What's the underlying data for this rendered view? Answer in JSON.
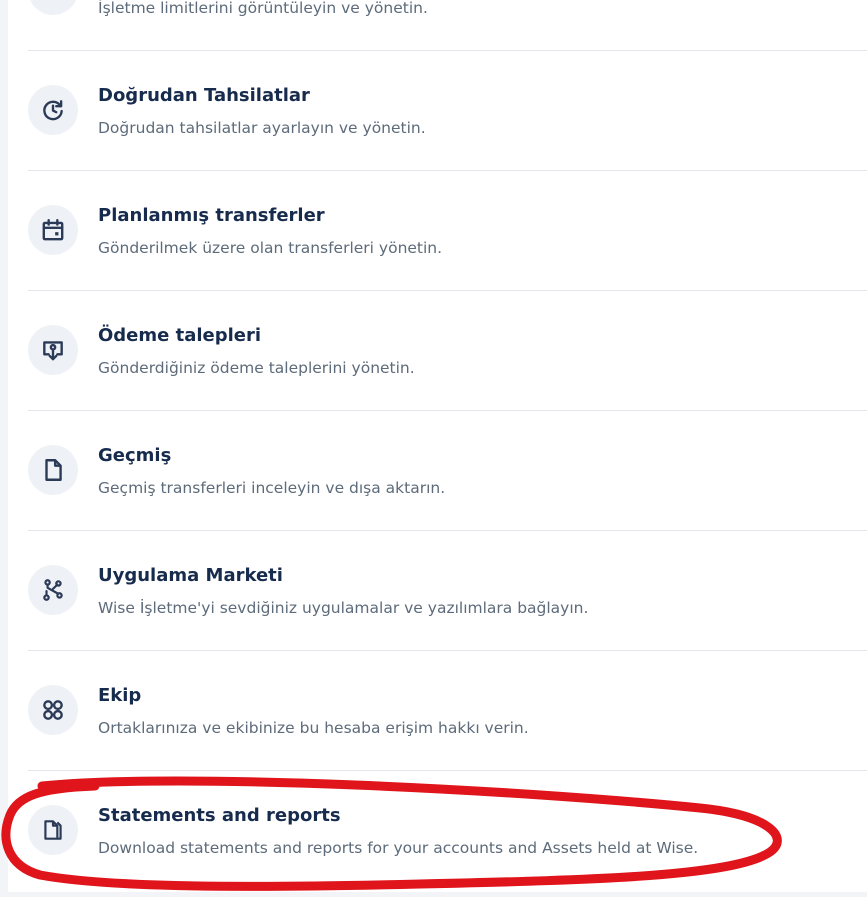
{
  "menu": {
    "items": [
      {
        "title": "",
        "description": "İşletme limitlerini görüntüleyin ve yönetin.",
        "icon": "gauge-icon"
      },
      {
        "title": "Doğrudan Tahsilatlar",
        "description": "Doğrudan tahsilatlar ayarlayın ve yönetin.",
        "icon": "clock-refresh-icon"
      },
      {
        "title": "Planlanmış transferler",
        "description": "Gönderilmek üzere olan transferleri yönetin.",
        "icon": "calendar-icon"
      },
      {
        "title": "Ödeme talepleri",
        "description": "Gönderdiğiniz ödeme taleplerini yönetin.",
        "icon": "payment-request-icon"
      },
      {
        "title": "Geçmiş",
        "description": "Geçmiş transferleri inceleyin ve dışa aktarın.",
        "icon": "document-icon"
      },
      {
        "title": "Uygulama Marketi",
        "description": "Wise İşletme'yi sevdiğiniz uygulamalar ve yazılımlara bağlayın.",
        "icon": "integrations-icon"
      },
      {
        "title": "Ekip",
        "description": "Ortaklarınıza ve ekibinize bu hesaba erişim hakkı verin.",
        "icon": "team-icon"
      },
      {
        "title": "Statements and reports",
        "description": "Download statements and reports for your accounts and Assets held at Wise.",
        "icon": "statements-icon"
      }
    ]
  },
  "colors": {
    "title": "#172b4d",
    "description": "#5d6b7a",
    "icon": "#2a3a57",
    "icon_background": "#eef2f6",
    "divider": "#e2e6eb",
    "annotation": "#e0141b"
  }
}
